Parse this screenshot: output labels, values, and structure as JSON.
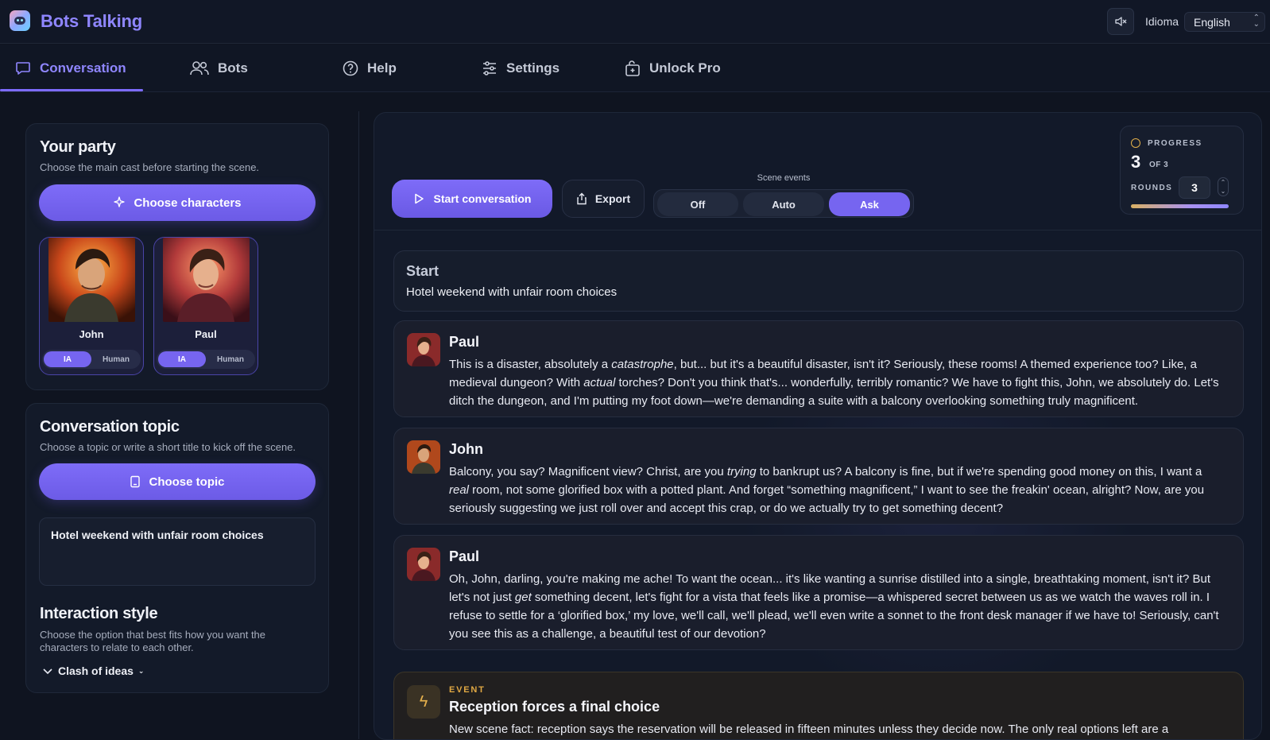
{
  "app": {
    "title": "Bots Talking",
    "lang_label": "Idioma",
    "lang_value": "English"
  },
  "tabs": [
    {
      "label": "Conversation",
      "icon": "chat-bubble-icon",
      "active": true
    },
    {
      "label": "Bots",
      "icon": "users-icon"
    },
    {
      "label": "Help",
      "icon": "help-circle-icon"
    },
    {
      "label": "Settings",
      "icon": "sliders-icon"
    },
    {
      "label": "Unlock Pro",
      "icon": "unlock-icon"
    }
  ],
  "party": {
    "title": "Your party",
    "subtitle": "Choose the main cast before starting the scene.",
    "choose_label": "Choose characters",
    "characters": [
      {
        "name": "John",
        "opt_ai": "IA",
        "opt_human": "Human",
        "mode": "IA"
      },
      {
        "name": "Paul",
        "opt_ai": "IA",
        "opt_human": "Human",
        "mode": "IA"
      }
    ]
  },
  "topic": {
    "title": "Conversation topic",
    "subtitle": "Choose a topic or write a short title to kick off the scene.",
    "choose_label": "Choose topic",
    "value": "Hotel weekend with unfair room choices"
  },
  "style": {
    "title": "Interaction style",
    "subtitle": "Choose the option that best fits how you want the characters to relate to each other.",
    "value": "Clash of ideas"
  },
  "toolbar": {
    "start_label": "Start conversation",
    "export_label": "Export",
    "events_label": "Scene events",
    "events_options": [
      "Off",
      "Auto",
      "Ask"
    ],
    "events_selected": "Ask"
  },
  "progress": {
    "title": "PROGRESS",
    "current": "3",
    "of_label": "OF 3",
    "rounds_label": "ROUNDS",
    "rounds_value": "3",
    "fraction": 1.0
  },
  "start": {
    "heading": "Start",
    "text": "Hotel weekend with unfair room choices"
  },
  "messages": [
    {
      "speaker": "Paul",
      "html": "This is a disaster, absolutely a <i>catastrophe</i>, but... but it's a beautiful disaster, isn't it? Seriously, these rooms! A themed experience too? Like, a medieval dungeon? With <i>actual</i> torches? Don't you think that's... wonderfully, terribly romantic? We have to fight this, John, we absolutely do. Let's ditch the dungeon, and I'm putting my foot down—we're demanding a suite with a balcony overlooking something truly magnificent."
    },
    {
      "speaker": "John",
      "html": "Balcony, you say? Magnificent view? Christ, are you <i>trying</i> to bankrupt us? A balcony is fine, but if we're spending good money on this, I want a <i>real</i> room, not some glorified box with a potted plant. And forget “something magnificent,” I want to see the freakin' ocean, alright? Now, are you seriously suggesting we just roll over and accept this crap, or do we actually try to get something decent?"
    },
    {
      "speaker": "Paul",
      "html": "Oh, John, darling, you're making me ache! To want the ocean... it's like wanting a sunrise distilled into a single, breathtaking moment, isn't it? But let's not just <i>get</i> something decent, let's fight for a vista that feels like a promise—a whispered secret between us as we watch the waves roll in. I refuse to settle for a ‘glorified box,’ my love, we'll call, we'll plead, we'll even write a sonnet to the front desk manager if we have to! Seriously, can't you see this as a challenge, a beautiful test of our devotion?"
    }
  ],
  "event": {
    "tag": "EVENT",
    "heading": "Reception forces a final choice",
    "text": "New scene fact: reception says the reservation will be released in fifteen minutes unless they decide now. The only real options left are a"
  },
  "colors": {
    "accent": "#7d6bff",
    "event": "#e0a843",
    "bg": "#0f1420"
  }
}
